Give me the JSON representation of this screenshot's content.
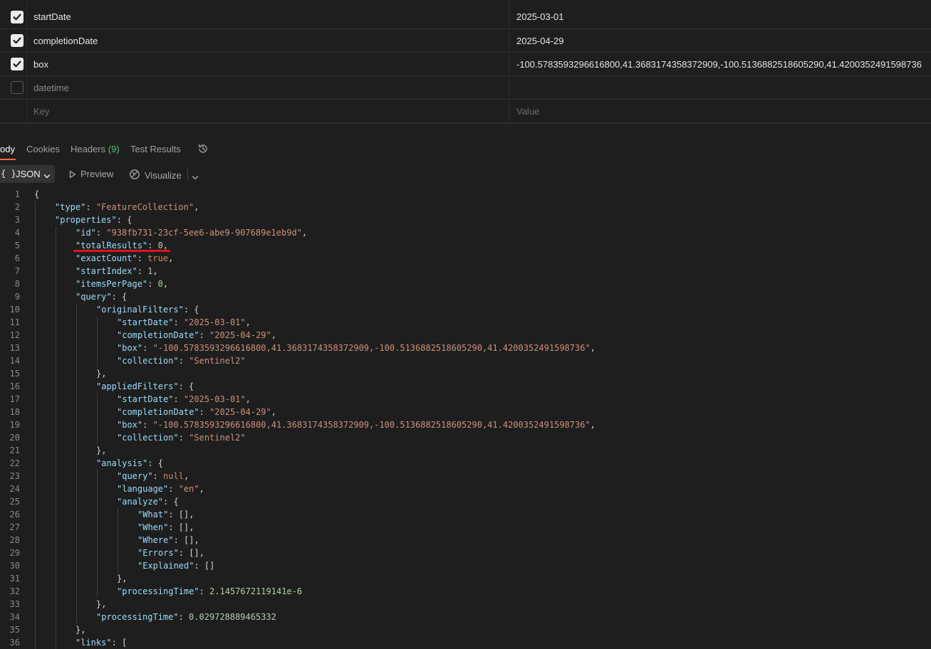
{
  "params": {
    "rows": [
      {
        "checked": true,
        "key": "startDate",
        "value": "2025-03-01"
      },
      {
        "checked": true,
        "key": "completionDate",
        "value": "2025-04-29"
      },
      {
        "checked": true,
        "key": "box",
        "value": "-100.5783593296616800,41.3683174358372909,-100.5136882518605290,41.4200352491598736"
      },
      {
        "checked": false,
        "key": "datetime",
        "value": ""
      }
    ],
    "placeholder": {
      "key": "Key",
      "value": "Value"
    }
  },
  "response_tabs": {
    "body": "ody",
    "cookies": "Cookies",
    "headers": "Headers",
    "headers_count": "(9)",
    "test_results": "Test Results"
  },
  "toolbar": {
    "format_braces": "{ }",
    "format": "JSON",
    "preview": "Preview",
    "visualize": "Visualize"
  },
  "colors": {
    "accent": "#ff6c37",
    "key": "#9cdcfe",
    "string": "#ce9178",
    "number": "#b5cea8",
    "annotation": "#e0141e"
  },
  "code_lines": [
    [
      [
        "p",
        "{"
      ]
    ],
    [
      [
        "k",
        "\"type\""
      ],
      [
        "p",
        ": "
      ],
      [
        "s",
        "\"FeatureCollection\""
      ],
      [
        "p",
        ","
      ]
    ],
    [
      [
        "k",
        "\"properties\""
      ],
      [
        "p",
        ": {"
      ]
    ],
    [
      [
        "k",
        "\"id\""
      ],
      [
        "p",
        ": "
      ],
      [
        "s",
        "\"938fb731-23cf-5ee6-abe9-907689e1eb9d\""
      ],
      [
        "p",
        ","
      ]
    ],
    [
      [
        "k",
        "\"totalResults\""
      ],
      [
        "p",
        ": "
      ],
      [
        "n",
        "0"
      ],
      [
        "p",
        ","
      ]
    ],
    [
      [
        "k",
        "\"exactCount\""
      ],
      [
        "p",
        ": "
      ],
      [
        "b",
        "true"
      ],
      [
        "p",
        ","
      ]
    ],
    [
      [
        "k",
        "\"startIndex\""
      ],
      [
        "p",
        ": "
      ],
      [
        "n",
        "1"
      ],
      [
        "p",
        ","
      ]
    ],
    [
      [
        "k",
        "\"itemsPerPage\""
      ],
      [
        "p",
        ": "
      ],
      [
        "n",
        "0"
      ],
      [
        "p",
        ","
      ]
    ],
    [
      [
        "k",
        "\"query\""
      ],
      [
        "p",
        ": {"
      ]
    ],
    [
      [
        "k",
        "\"originalFilters\""
      ],
      [
        "p",
        ": {"
      ]
    ],
    [
      [
        "k",
        "\"startDate\""
      ],
      [
        "p",
        ": "
      ],
      [
        "s",
        "\"2025-03-01\""
      ],
      [
        "p",
        ","
      ]
    ],
    [
      [
        "k",
        "\"completionDate\""
      ],
      [
        "p",
        ": "
      ],
      [
        "s",
        "\"2025-04-29\""
      ],
      [
        "p",
        ","
      ]
    ],
    [
      [
        "k",
        "\"box\""
      ],
      [
        "p",
        ": "
      ],
      [
        "s",
        "\"-100.5783593296616800,41.3683174358372909,-100.5136882518605290,41.4200352491598736\""
      ],
      [
        "p",
        ","
      ]
    ],
    [
      [
        "k",
        "\"collection\""
      ],
      [
        "p",
        ": "
      ],
      [
        "s",
        "\"Sentinel2\""
      ]
    ],
    [
      [
        "p",
        "},"
      ]
    ],
    [
      [
        "k",
        "\"appliedFilters\""
      ],
      [
        "p",
        ": {"
      ]
    ],
    [
      [
        "k",
        "\"startDate\""
      ],
      [
        "p",
        ": "
      ],
      [
        "s",
        "\"2025-03-01\""
      ],
      [
        "p",
        ","
      ]
    ],
    [
      [
        "k",
        "\"completionDate\""
      ],
      [
        "p",
        ": "
      ],
      [
        "s",
        "\"2025-04-29\""
      ],
      [
        "p",
        ","
      ]
    ],
    [
      [
        "k",
        "\"box\""
      ],
      [
        "p",
        ": "
      ],
      [
        "s",
        "\"-100.5783593296616800,41.3683174358372909,-100.5136882518605290,41.4200352491598736\""
      ],
      [
        "p",
        ","
      ]
    ],
    [
      [
        "k",
        "\"collection\""
      ],
      [
        "p",
        ": "
      ],
      [
        "s",
        "\"Sentinel2\""
      ]
    ],
    [
      [
        "p",
        "},"
      ]
    ],
    [
      [
        "k",
        "\"analysis\""
      ],
      [
        "p",
        ": {"
      ]
    ],
    [
      [
        "k",
        "\"query\""
      ],
      [
        "p",
        ": "
      ],
      [
        "b",
        "null"
      ],
      [
        "p",
        ","
      ]
    ],
    [
      [
        "k",
        "\"language\""
      ],
      [
        "p",
        ": "
      ],
      [
        "s",
        "\"en\""
      ],
      [
        "p",
        ","
      ]
    ],
    [
      [
        "k",
        "\"analyze\""
      ],
      [
        "p",
        ": {"
      ]
    ],
    [
      [
        "k",
        "\"What\""
      ],
      [
        "p",
        ": [],"
      ]
    ],
    [
      [
        "k",
        "\"When\""
      ],
      [
        "p",
        ": [],"
      ]
    ],
    [
      [
        "k",
        "\"Where\""
      ],
      [
        "p",
        ": [],"
      ]
    ],
    [
      [
        "k",
        "\"Errors\""
      ],
      [
        "p",
        ": [],"
      ]
    ],
    [
      [
        "k",
        "\"Explained\""
      ],
      [
        "p",
        ": []"
      ]
    ],
    [
      [
        "p",
        "},"
      ]
    ],
    [
      [
        "k",
        "\"processingTime\""
      ],
      [
        "p",
        ": "
      ],
      [
        "n",
        "2.1457672119141e-6"
      ]
    ],
    [
      [
        "p",
        "},"
      ]
    ],
    [
      [
        "k",
        "\"processingTime\""
      ],
      [
        "p",
        ": "
      ],
      [
        "n",
        "0.029728889465332"
      ]
    ],
    [
      [
        "p",
        "},"
      ]
    ],
    [
      [
        "k",
        "\"links\""
      ],
      [
        "p",
        ": ["
      ]
    ]
  ]
}
